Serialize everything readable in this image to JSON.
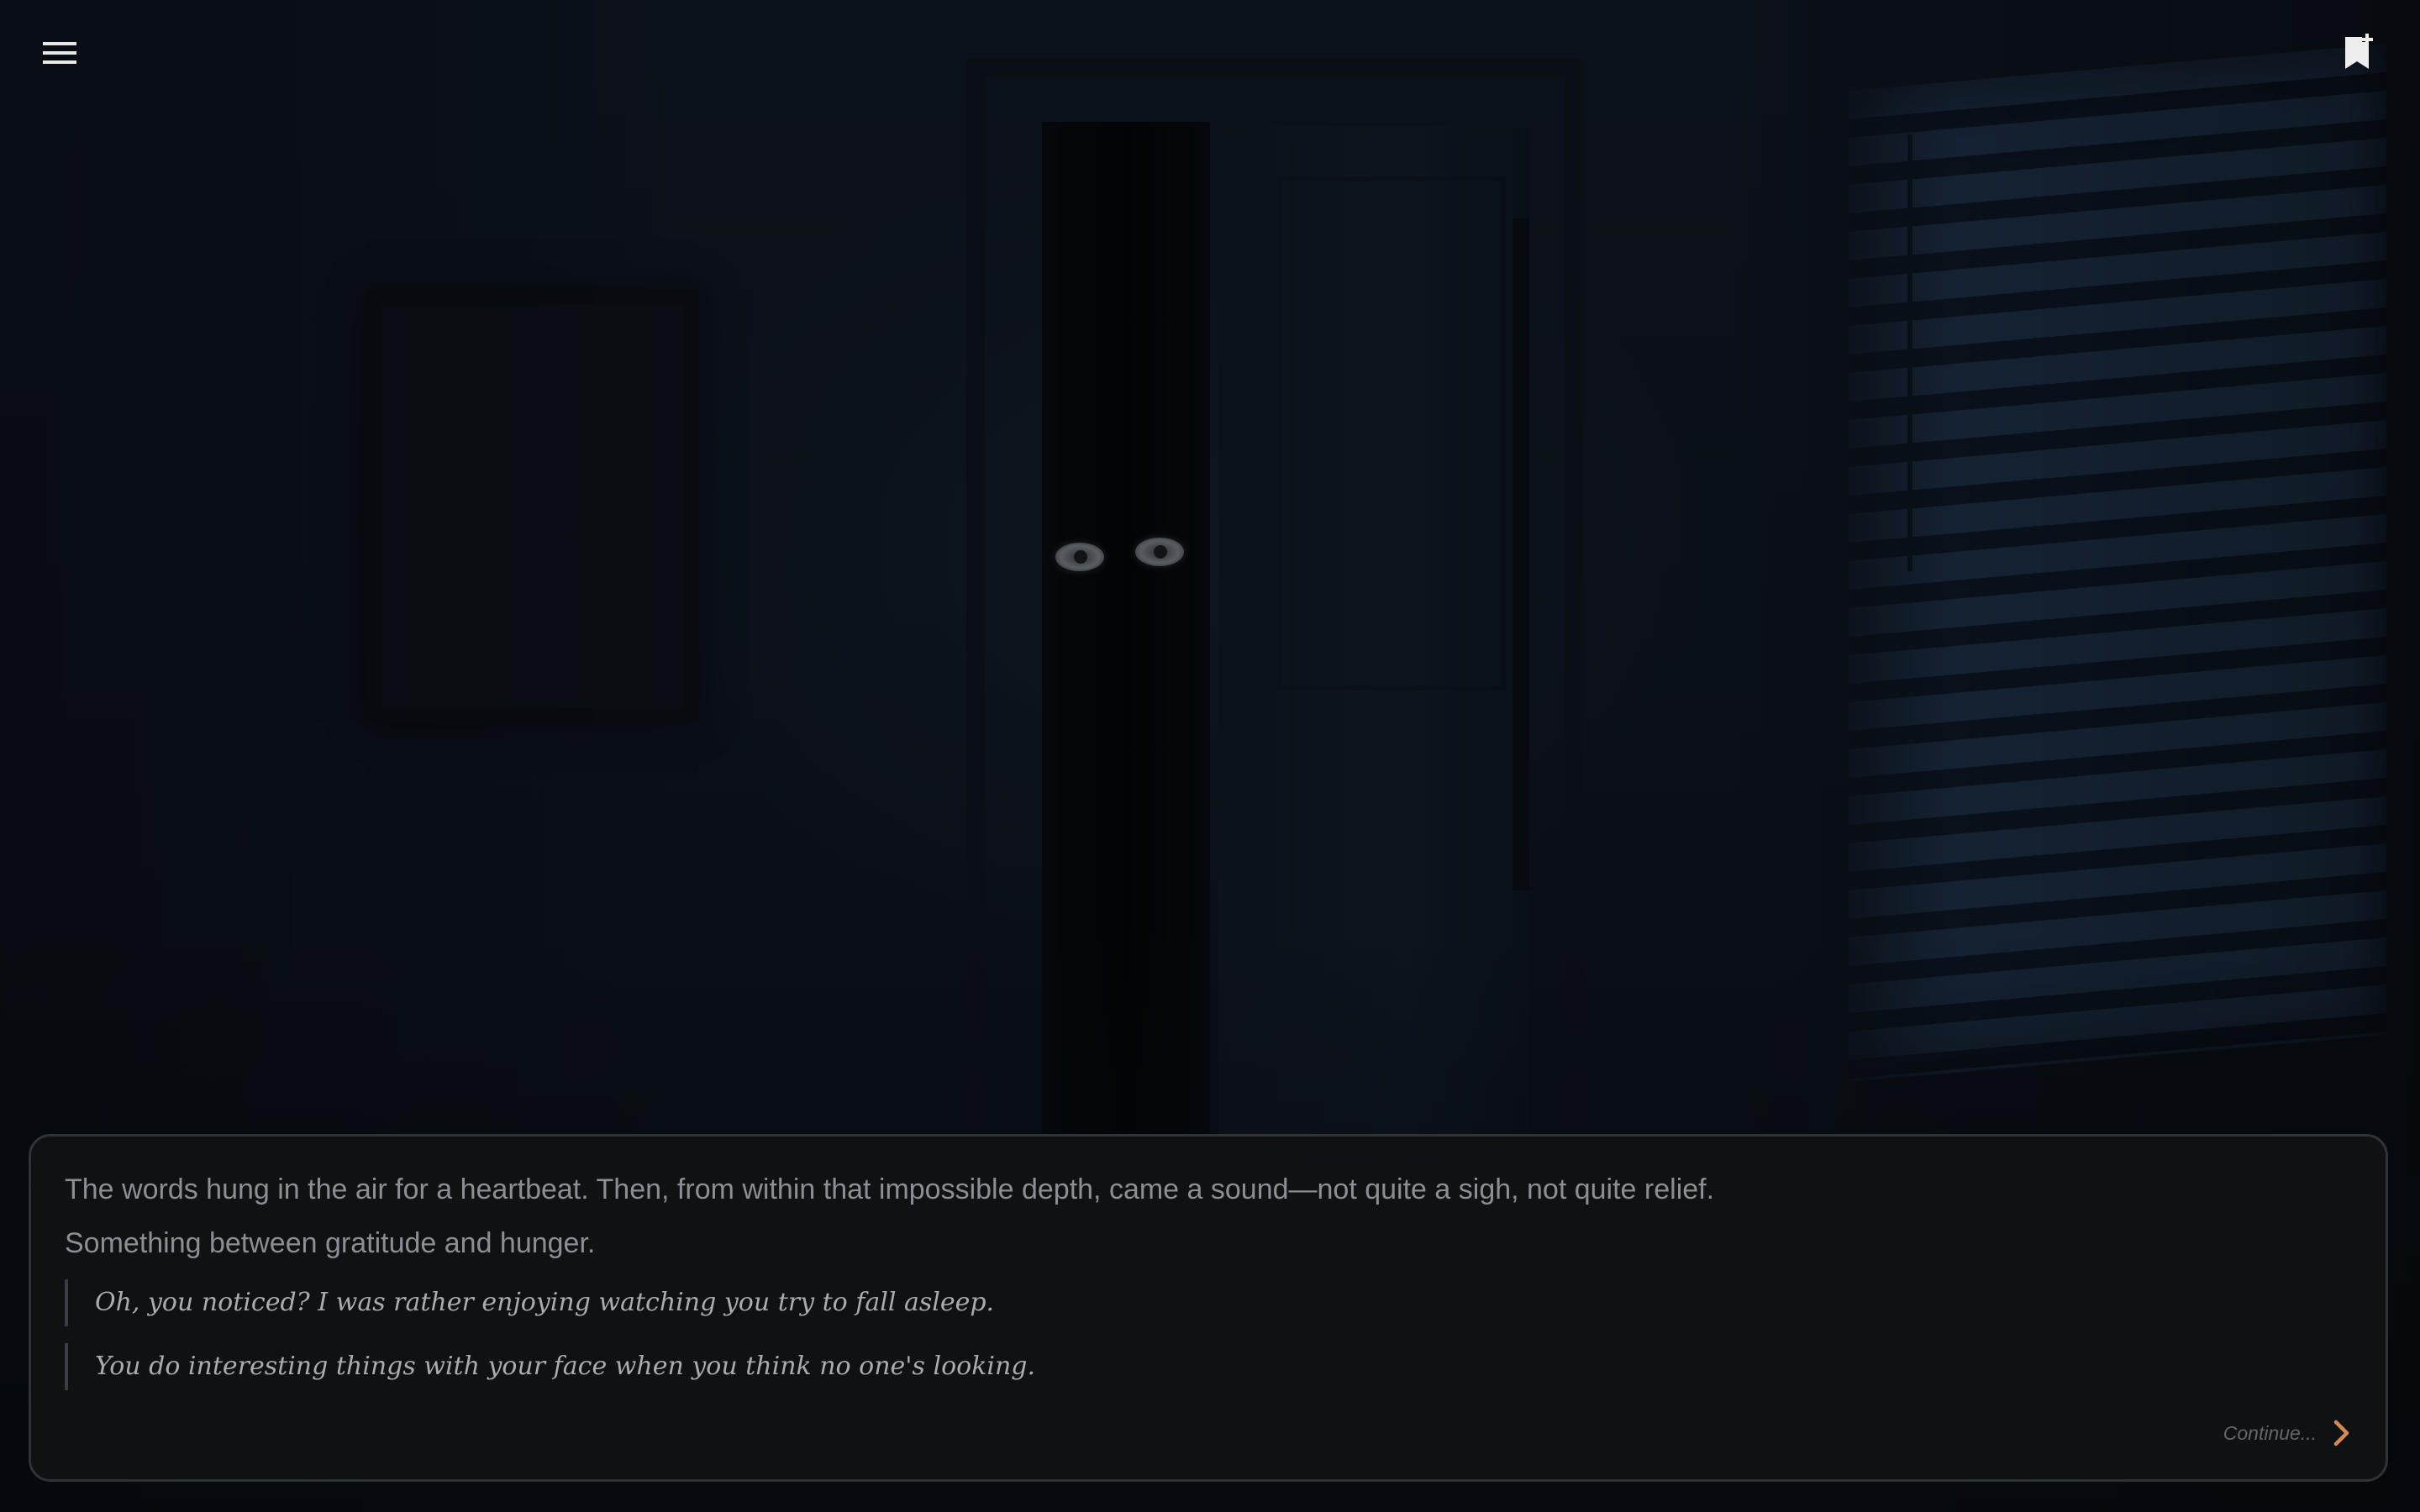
{
  "scene": {
    "background": "dark bedroom at night",
    "eyes_color": "#5a5d62"
  },
  "header": {
    "menu_icon": "hamburger-menu-icon",
    "bookmark_icon": "bookmark-add-icon"
  },
  "dialogue": {
    "narration": [
      "The words hung in the air for a heartbeat. Then, from within that impossible depth, came a sound—not quite a sigh, not quite relief.",
      "Something between gratitude and hunger."
    ],
    "speech": [
      "Oh, you noticed? I was rather enjoying watching you try to fall asleep.",
      "You do interesting things with your face when you think no one's looking."
    ],
    "continue_label": "Continue...",
    "continue_icon": "chevron-right-icon",
    "accent_color": "#d18a54"
  }
}
